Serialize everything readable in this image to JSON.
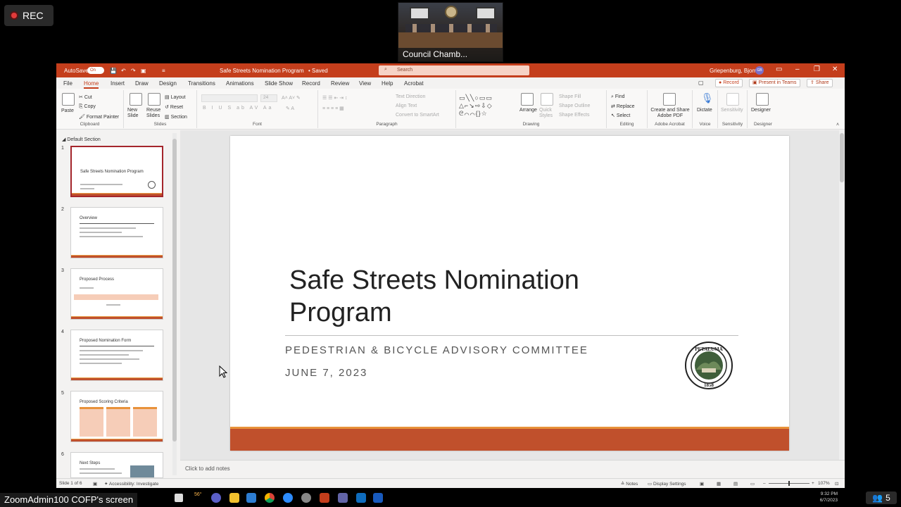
{
  "zoom": {
    "rec_label": "REC",
    "camera_label": "Council Chamb...",
    "screen_share_label": "ZoomAdmin100 COFP's screen",
    "participants_count": "5"
  },
  "titlebar": {
    "autosave": "AutoSave",
    "autosave_state": "On",
    "document": "Safe Streets Nomination Program",
    "saved": "• Saved",
    "search_placeholder": "Search",
    "user": "Griepenburg, Bjorn",
    "user_initials": "GB"
  },
  "menu": {
    "tabs": [
      "File",
      "Home",
      "Insert",
      "Draw",
      "Design",
      "Transitions",
      "Animations",
      "Slide Show",
      "Record",
      "Review",
      "View",
      "Help",
      "Acrobat"
    ],
    "record_btn": "Record",
    "present_teams": "Present in Teams",
    "share": "Share"
  },
  "ribbon": {
    "clipboard": {
      "paste": "Paste",
      "cut": "Cut",
      "copy": "Copy",
      "format_painter": "Format Painter",
      "label": "Clipboard"
    },
    "slides": {
      "new_slide": "New Slide",
      "reuse": "Reuse Slides",
      "layout": "Layout",
      "reset": "Reset",
      "section": "Section",
      "label": "Slides"
    },
    "font": {
      "label": "Font",
      "size": "24"
    },
    "paragraph": {
      "text_direction": "Text Direction",
      "align_text": "Align Text",
      "smartart": "Convert to SmartArt",
      "label": "Paragraph"
    },
    "drawing": {
      "arrange": "Arrange",
      "quick_styles": "Quick Styles",
      "shape_fill": "Shape Fill",
      "shape_outline": "Shape Outline",
      "shape_effects": "Shape Effects",
      "label": "Drawing"
    },
    "editing": {
      "find": "Find",
      "replace": "Replace",
      "select": "Select",
      "label": "Editing"
    },
    "acrobat": {
      "create_share": "Create and Share Adobe PDF",
      "label": "Adobe Acrobat"
    },
    "voice": {
      "dictate": "Dictate",
      "label": "Voice"
    },
    "sensitivity": {
      "button": "Sensitivity",
      "label": "Sensitivity"
    },
    "designer": {
      "button": "Designer",
      "label": "Designer"
    }
  },
  "panel": {
    "section": "Default Section",
    "thumbnails": [
      {
        "num": "1",
        "title": "Safe Streets Nomination Program"
      },
      {
        "num": "2",
        "title": "Overview"
      },
      {
        "num": "3",
        "title": "Proposed Process"
      },
      {
        "num": "4",
        "title": "Proposed Nomination Form"
      },
      {
        "num": "5",
        "title": "Proposed Scoring Criteria"
      },
      {
        "num": "6",
        "title": "Next Steps"
      }
    ]
  },
  "slide": {
    "title_line1": "Safe Streets Nomination",
    "title_line2": "Program",
    "subtitle": "PEDESTRIAN & BICYCLE ADVISORY COMMITTEE",
    "date": "JUNE 7, 2023",
    "seal_top": "PETALUMA",
    "seal_year": "1858"
  },
  "notes": {
    "placeholder": "Click to add notes"
  },
  "status": {
    "slide_count": "Slide 1 of 6",
    "accessibility": "Accessibility: Investigate",
    "notes": "Notes",
    "display": "Display Settings",
    "zoom": "107%"
  },
  "taskbar": {
    "weather": "56°",
    "time": "9:32 PM",
    "date": "6/7/2023"
  },
  "colors": {
    "accent": "#c43e1c",
    "slide_bar": "#c0502c",
    "slide_bar_top": "#e8923a"
  }
}
